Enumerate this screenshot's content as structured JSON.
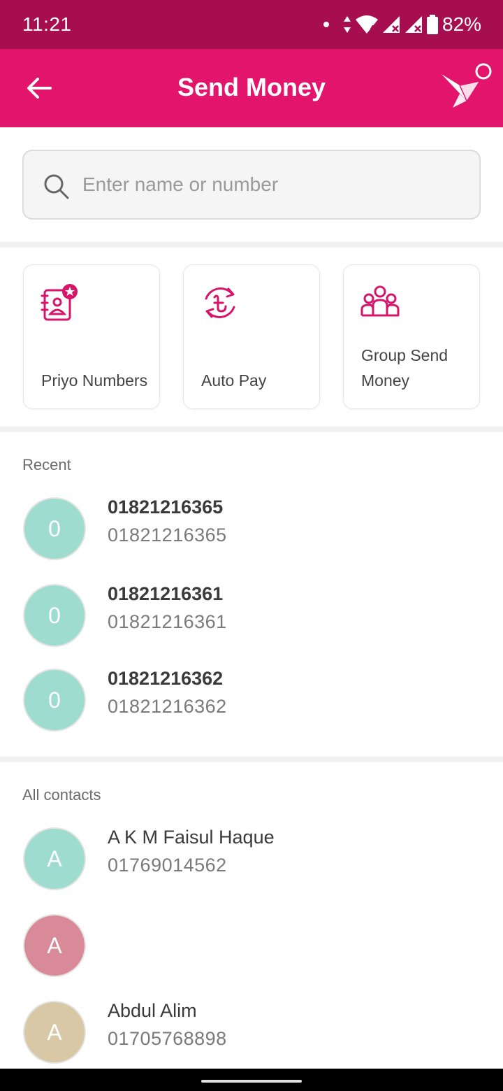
{
  "status_bar": {
    "time": "11:21",
    "battery": "82%",
    "icons": [
      "notification-dot-icon",
      "data-arrows-icon",
      "wifi-icon",
      "signal-icon",
      "signal-icon",
      "battery-icon"
    ]
  },
  "app_bar": {
    "title": "Send Money",
    "back_icon": "arrow-left-icon",
    "logo_icon": "bkash-bird-logo"
  },
  "search": {
    "placeholder": "Enter name or number",
    "value": ""
  },
  "actions": [
    {
      "label": "Priyo Numbers",
      "icon": "contact-book-star-icon"
    },
    {
      "label": "Auto Pay",
      "icon": "taka-recycle-icon"
    },
    {
      "label": "Group Send Money",
      "icon": "group-people-icon"
    }
  ],
  "recent": {
    "header": "Recent",
    "items": [
      {
        "initial": "0",
        "name": "01821216365",
        "number": "01821216365"
      },
      {
        "initial": "0",
        "name": "01821216361",
        "number": "01821216361"
      },
      {
        "initial": "0",
        "name": "01821216362",
        "number": "01821216362"
      }
    ]
  },
  "contacts": {
    "header": "All contacts",
    "items": [
      {
        "initial": "A",
        "name": "A K M Faisul Haque",
        "number": "01769014562"
      },
      {
        "initial": "A",
        "name": "",
        "number": ""
      },
      {
        "initial": "A",
        "name": "Abdul Alim",
        "number": "01705768898"
      }
    ]
  },
  "colors": {
    "status_bar": "#a60e50",
    "brand": "#e2146c",
    "avatar_teal": "#9edcd0",
    "avatar_pink": "#d98a98",
    "avatar_beige": "#d8c8a6"
  }
}
